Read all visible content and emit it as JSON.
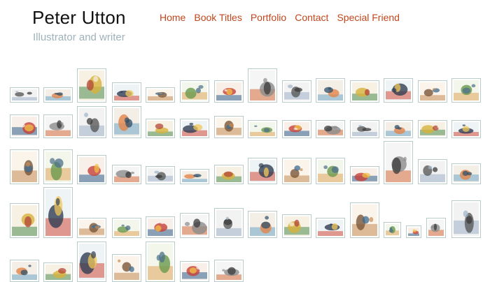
{
  "header": {
    "title": "Peter Utton",
    "subtitle": "Illustrator and writer"
  },
  "nav": {
    "items": [
      {
        "label": "Home"
      },
      {
        "label": "Book Titles"
      },
      {
        "label": "Portfolio"
      },
      {
        "label": "Contact"
      },
      {
        "label": "Special Friend"
      }
    ]
  },
  "gallery": {
    "palettes": [
      [
        "#f2f2f2",
        "#5a5a5a",
        "#9fb2c8",
        "#3b3b3b"
      ],
      [
        "#f4efe6",
        "#e2844a",
        "#6fa6c9",
        "#2f4f6a"
      ],
      [
        "#f7f1e3",
        "#d7b33c",
        "#4e8c52",
        "#b34437"
      ],
      [
        "#eef3f5",
        "#2f3d52",
        "#d24d3b",
        "#f0c75a"
      ],
      [
        "#fbf4ea",
        "#7b5638",
        "#c68c54",
        "#3d6b8f"
      ],
      [
        "#f3f6ea",
        "#6a9a4d",
        "#e0a55b",
        "#4b6f8a"
      ],
      [
        "#f8efe8",
        "#c7403a",
        "#2d5e8c",
        "#f1c043"
      ],
      [
        "#f5f5f5",
        "#8c8c8c",
        "#d46b3a",
        "#3a3a3a"
      ]
    ]
  }
}
